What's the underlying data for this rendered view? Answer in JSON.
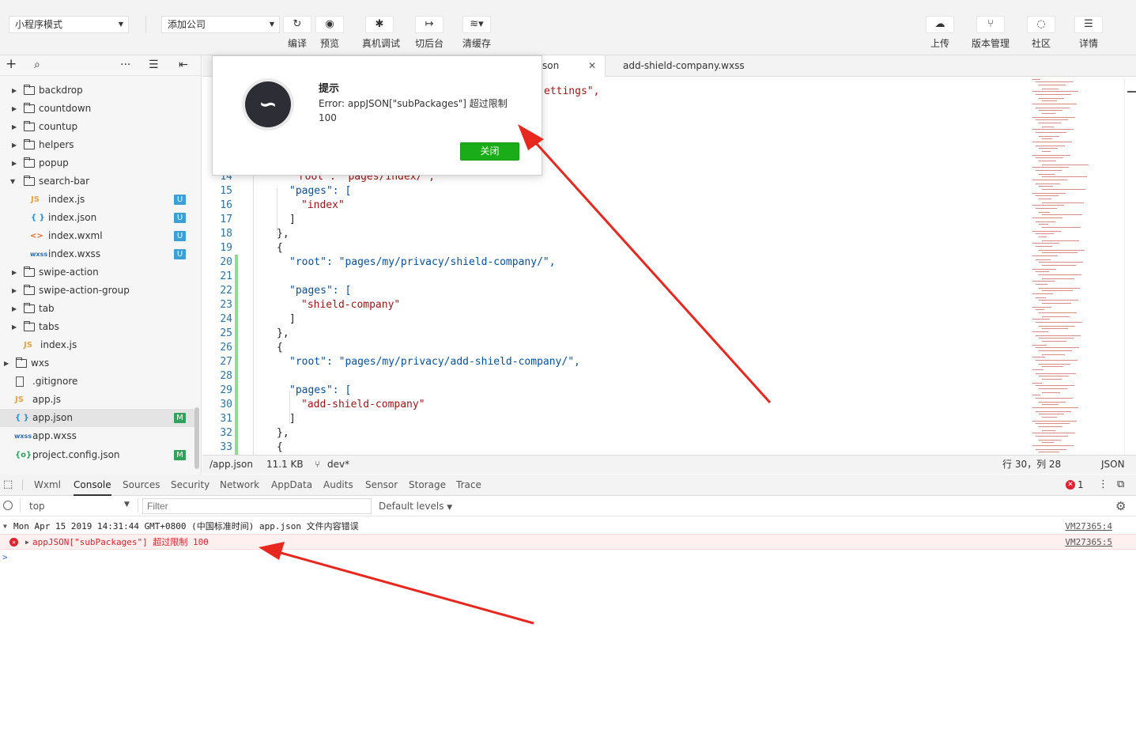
{
  "toolbar": {
    "mode_select": "小程序模式",
    "compile_select": "添加公司",
    "left_buttons": [
      {
        "label": "编译",
        "icon": "refresh-icon"
      },
      {
        "label": "预览",
        "icon": "eye-icon"
      },
      {
        "label": "真机调试",
        "icon": "bug-icon"
      },
      {
        "label": "切后台",
        "icon": "switch-background-icon"
      },
      {
        "label": "清缓存",
        "icon": "layers-icon"
      }
    ],
    "right_buttons": [
      {
        "label": "上传",
        "icon": "cloud-upload-icon"
      },
      {
        "label": "版本管理",
        "icon": "branch-icon"
      },
      {
        "label": "社区",
        "icon": "chat-icon"
      },
      {
        "label": "详情",
        "icon": "menu-icon"
      }
    ]
  },
  "sidebar": {
    "tree": [
      {
        "name": "backdrop",
        "kind": "folder",
        "expanded": false
      },
      {
        "name": "countdown",
        "kind": "folder",
        "expanded": false
      },
      {
        "name": "countup",
        "kind": "folder",
        "expanded": false
      },
      {
        "name": "helpers",
        "kind": "folder",
        "expanded": false
      },
      {
        "name": "popup",
        "kind": "folder",
        "expanded": false
      },
      {
        "name": "search-bar",
        "kind": "folder",
        "expanded": true
      },
      {
        "name": "index.js",
        "kind": "js",
        "badge": "U"
      },
      {
        "name": "index.json",
        "kind": "json",
        "badge": "U"
      },
      {
        "name": "index.wxml",
        "kind": "wxml",
        "badge": "U"
      },
      {
        "name": "index.wxss",
        "kind": "wxss",
        "badge": "U"
      },
      {
        "name": "swipe-action",
        "kind": "folder",
        "expanded": false
      },
      {
        "name": "swipe-action-group",
        "kind": "folder",
        "expanded": false
      },
      {
        "name": "tab",
        "kind": "folder",
        "expanded": false
      },
      {
        "name": "tabs",
        "kind": "folder",
        "expanded": false
      },
      {
        "name": "index.js",
        "kind": "js"
      },
      {
        "name": "wxs",
        "kind": "folder",
        "expanded": false
      },
      {
        "name": ".gitignore",
        "kind": "file"
      },
      {
        "name": "app.js",
        "kind": "js"
      },
      {
        "name": "app.json",
        "kind": "json",
        "badge": "M",
        "selected": true
      },
      {
        "name": "app.wxss",
        "kind": "wxss"
      },
      {
        "name": "project.config.json",
        "kind": "config",
        "badge": "M"
      }
    ]
  },
  "editor": {
    "tabs": [
      {
        "label": "son",
        "active": true,
        "close": "✕"
      },
      {
        "label": "add-shield-company.wxss",
        "active": false
      }
    ],
    "top_fragment": "ettings\",",
    "hidden_line": "\"root\": \"pages/index/\",",
    "lines": [
      {
        "n": "14",
        "text": ""
      },
      {
        "n": "15",
        "text": "\"pages\": ["
      },
      {
        "n": "16",
        "text": "\"index\""
      },
      {
        "n": "17",
        "text": "]"
      },
      {
        "n": "18",
        "text": "},"
      },
      {
        "n": "19",
        "text": "{"
      },
      {
        "n": "20",
        "text": "\"root\": \"pages/my/privacy/shield-company/\","
      },
      {
        "n": "21",
        "text": ""
      },
      {
        "n": "22",
        "text": "\"pages\": ["
      },
      {
        "n": "23",
        "text": "\"shield-company\""
      },
      {
        "n": "24",
        "text": "]"
      },
      {
        "n": "25",
        "text": "},"
      },
      {
        "n": "26",
        "text": "{"
      },
      {
        "n": "27",
        "text": "\"root\": \"pages/my/privacy/add-shield-company/\","
      },
      {
        "n": "28",
        "text": ""
      },
      {
        "n": "29",
        "text": "\"pages\": ["
      },
      {
        "n": "30",
        "text": "\"add-shield-company\""
      },
      {
        "n": "31",
        "text": "]"
      },
      {
        "n": "32",
        "text": "},"
      },
      {
        "n": "33",
        "text": "{"
      }
    ]
  },
  "statusbar": {
    "path": "/app.json",
    "size": "11.1 KB",
    "branch": "dev*",
    "position": "行 30，列 28",
    "language": "JSON"
  },
  "devtools": {
    "tabs": [
      "Wxml",
      "Console",
      "Sources",
      "Security",
      "Network",
      "AppData",
      "Audits",
      "Sensor",
      "Storage",
      "Trace"
    ],
    "active_tab": "Console",
    "error_count": "1",
    "context": "top",
    "filter_placeholder": "Filter",
    "levels": "Default levels",
    "messages": [
      {
        "text": "Mon Apr 15 2019 14:31:44 GMT+0800 (中国标准时间)  app.json 文件内容错误",
        "source": "VM27365:4",
        "level": "info"
      },
      {
        "text": "appJSON[\"subPackages\"] 超过限制 100",
        "source": "VM27365:5",
        "level": "error"
      }
    ],
    "prompt": ">"
  },
  "modal": {
    "title": "提示",
    "message": "Error: appJSON[\"subPackages\"] 超过限制",
    "value": "100",
    "close_label": "关闭"
  },
  "colors": {
    "accent_green": "#1aad19",
    "error_red": "#e0202a",
    "annotation_arrow": "#e8281e"
  }
}
